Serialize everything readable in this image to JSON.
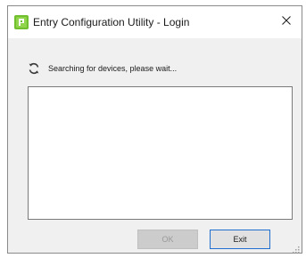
{
  "window": {
    "title": "Entry Configuration Utility - Login",
    "app_icon": "app-icon",
    "close_icon": "close-icon",
    "close_glyph": "×"
  },
  "status": {
    "icon": "refresh-icon",
    "text": "Searching for devices, please wait..."
  },
  "device_list": {
    "items": []
  },
  "buttons": {
    "ok_label": "OK",
    "ok_enabled": false,
    "exit_label": "Exit"
  },
  "colors": {
    "accent": "#1e6fd0",
    "app_icon_green": "#6fbf2e"
  }
}
